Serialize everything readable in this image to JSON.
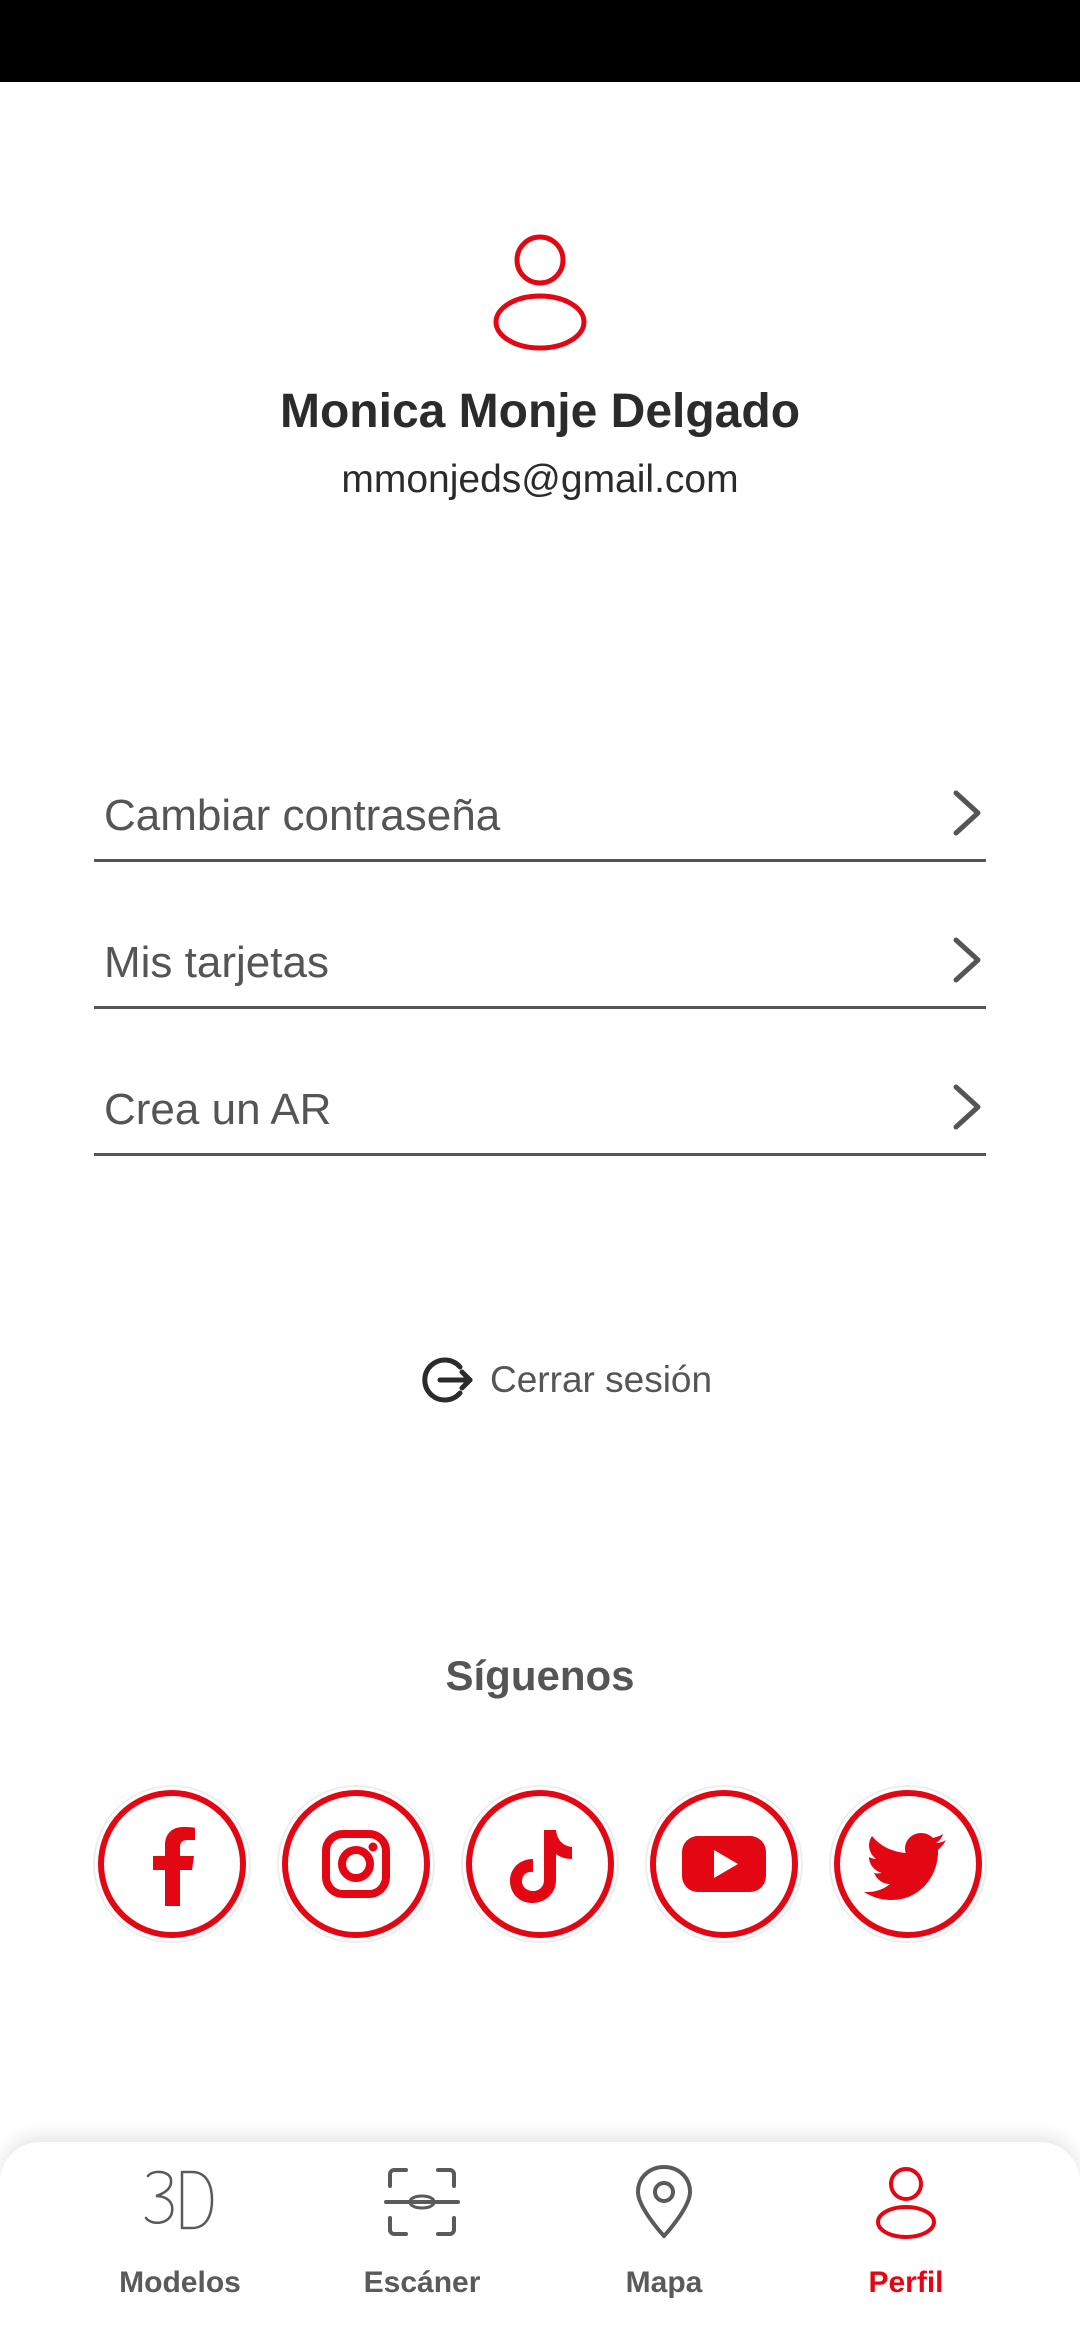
{
  "profile": {
    "name": "Monica Monje Delgado",
    "email": "mmonjeds@gmail.com"
  },
  "menu": {
    "items": [
      {
        "label": "Cambiar contraseña"
      },
      {
        "label": "Mis tarjetas"
      },
      {
        "label": "Crea un AR"
      }
    ]
  },
  "logout": {
    "label": "Cerrar sesión"
  },
  "social": {
    "title": "Síguenos",
    "networks": [
      "facebook-icon",
      "instagram-icon",
      "tiktok-icon",
      "youtube-icon",
      "twitter-icon"
    ]
  },
  "nav": {
    "items": [
      {
        "label": "Modelos",
        "icon": "3d-icon"
      },
      {
        "label": "Escáner",
        "icon": "scanner-icon"
      },
      {
        "label": "Mapa",
        "icon": "map-pin-icon"
      },
      {
        "label": "Perfil",
        "icon": "user-icon",
        "active": true
      }
    ]
  },
  "colors": {
    "accent": "#e30613",
    "text": "#555555",
    "dark_text": "#2b2b2b"
  }
}
